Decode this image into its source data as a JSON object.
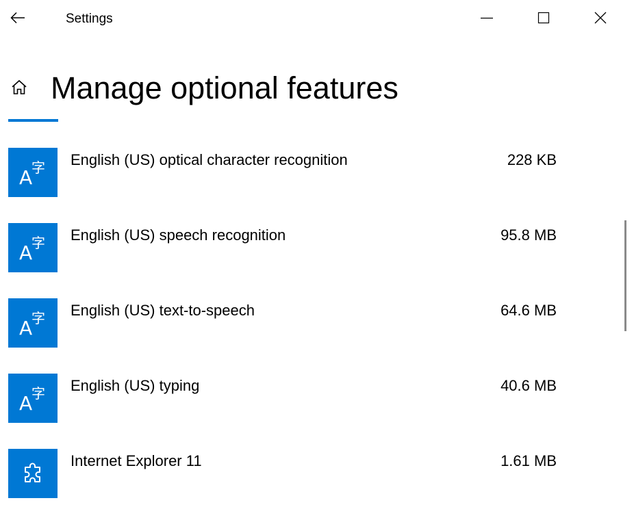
{
  "window": {
    "title": "Settings",
    "back_icon": "arrow-left-icon",
    "minimize_icon": "minimize-icon",
    "maximize_icon": "maximize-icon",
    "close_icon": "close-icon"
  },
  "page": {
    "title": "Manage optional features",
    "home_icon": "home-icon",
    "accent_color": "#0078d4"
  },
  "features": [
    {
      "name": "English (US) optical character recognition",
      "size": "228 KB",
      "icon": "language-icon"
    },
    {
      "name": "English (US) speech recognition",
      "size": "95.8 MB",
      "icon": "language-icon"
    },
    {
      "name": "English (US) text-to-speech",
      "size": "64.6 MB",
      "icon": "language-icon"
    },
    {
      "name": "English (US) typing",
      "size": "40.6 MB",
      "icon": "language-icon"
    },
    {
      "name": "Internet Explorer 11",
      "size": "1.61 MB",
      "icon": "puzzle-piece-icon"
    }
  ]
}
